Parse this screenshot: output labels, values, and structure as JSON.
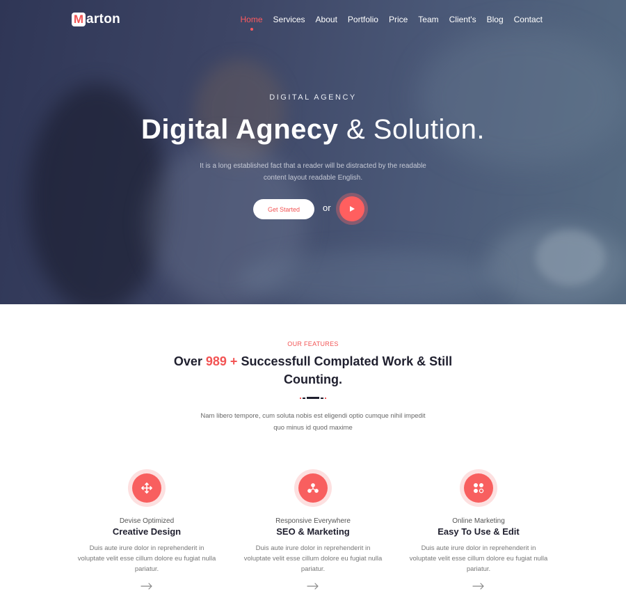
{
  "brand": {
    "logo_letter": "M",
    "logo_rest": "arton"
  },
  "nav": {
    "items": [
      {
        "label": "Home"
      },
      {
        "label": "Services"
      },
      {
        "label": "About"
      },
      {
        "label": "Portfolio"
      },
      {
        "label": "Price"
      },
      {
        "label": "Team"
      },
      {
        "label": "Client's"
      },
      {
        "label": "Blog"
      },
      {
        "label": "Contact"
      }
    ],
    "active": "Home"
  },
  "hero": {
    "kicker": "DIGITAL AGENCY",
    "title_strong": "Digital Agnecy",
    "title_light": "& Solution.",
    "description": "It is a long established fact that a reader will be distracted by the readable content layout readable English.",
    "cta_label": "Get Started",
    "or_text": "or"
  },
  "features": {
    "kicker": "OUR FEATURES",
    "title_before": "Over",
    "title_accent": "989 +",
    "title_after": "Successfull Complated Work & Still Counting.",
    "description": "Nam libero tempore, cum soluta nobis est eligendi optio cumque nihil impedit quo minus id quod maxime",
    "cards": [
      {
        "icon": "move-arrows-icon",
        "subtitle": "Devise Optimized",
        "title": "Creative Design",
        "text": "Duis aute irure dolor in reprehenderit in voluptate velit esse cillum dolore eu fugiat nulla pariatur."
      },
      {
        "icon": "network-nodes-icon",
        "subtitle": "Responsive Everywhere",
        "title": "SEO & Marketing",
        "text": "Duis aute irure dolor in reprehenderit in voluptate velit esse cillum dolore eu fugiat nulla pariatur."
      },
      {
        "icon": "apps-grid-icon",
        "subtitle": "Online Marketing",
        "title": "Easy To Use & Edit",
        "text": "Duis aute irure dolor in reprehenderit in voluptate velit esse cillum dolore eu fugiat nulla pariatur."
      }
    ]
  },
  "colors": {
    "accent": "#f25454",
    "hero_bg": "#3d4565",
    "heading": "#1f1f2e"
  }
}
